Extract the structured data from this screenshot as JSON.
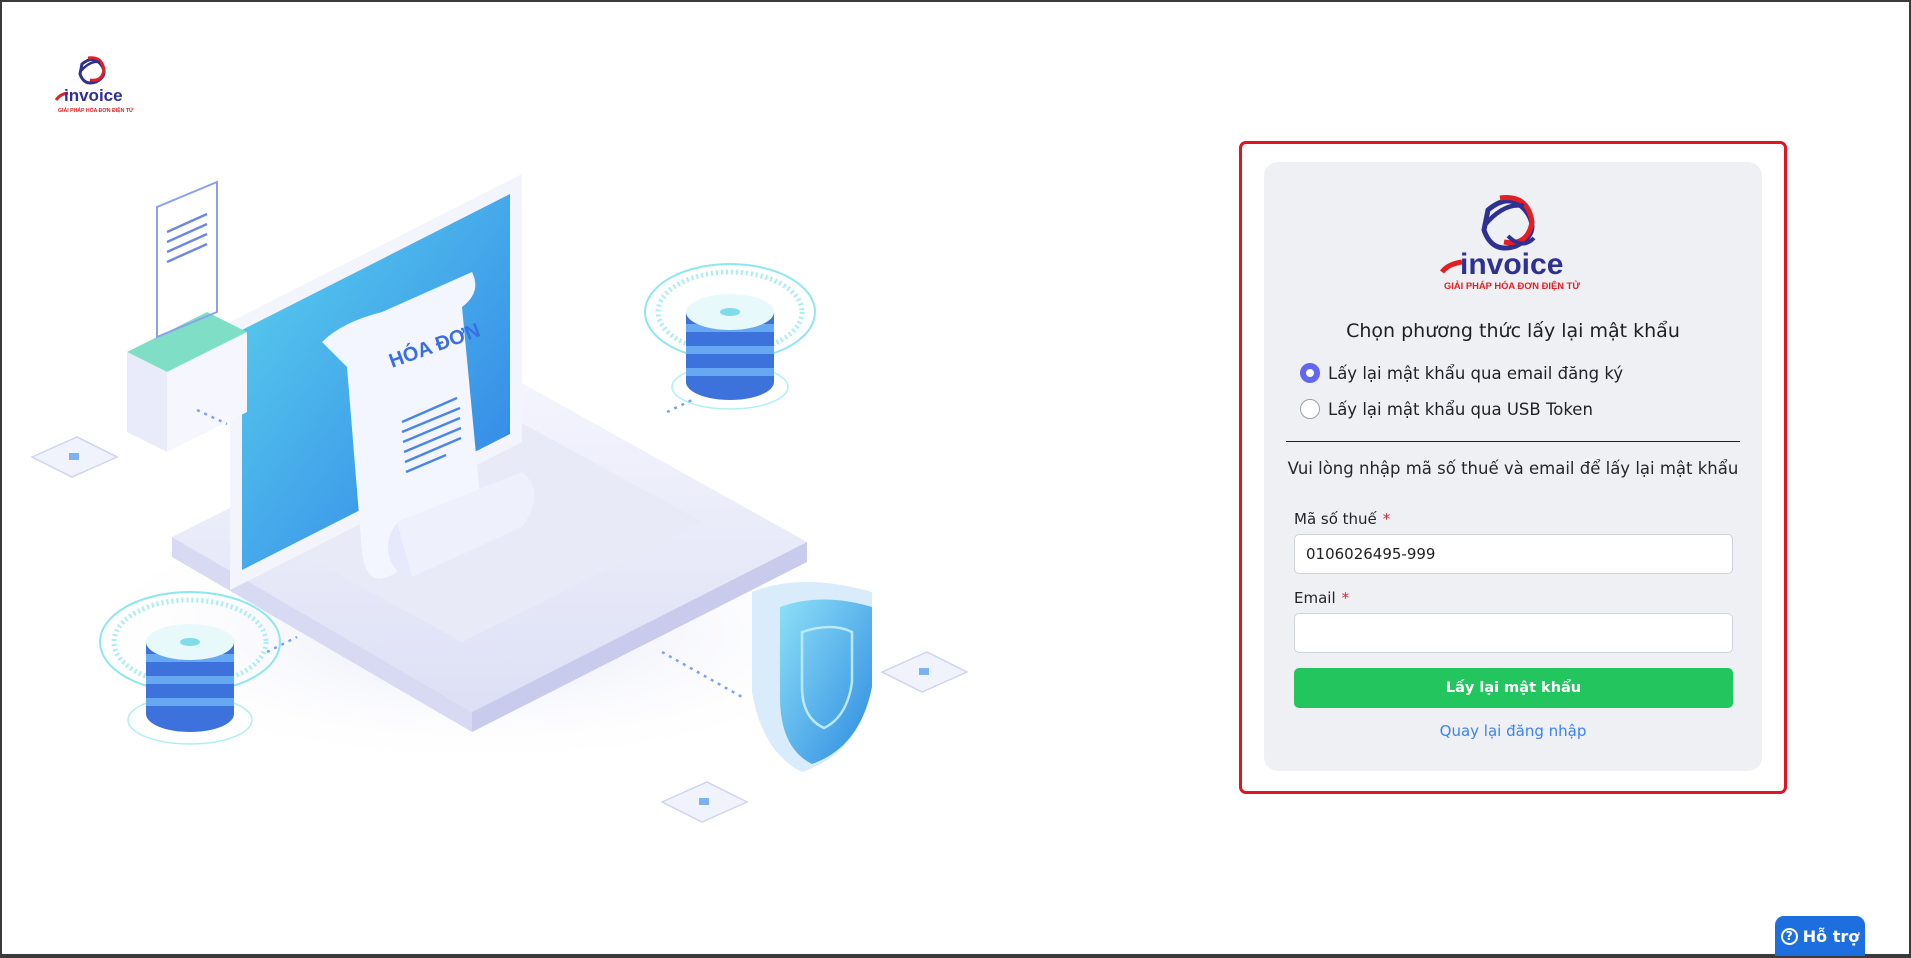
{
  "brand": {
    "name": "invoice",
    "tagline": "GIẢI PHÁP HÓA ĐƠN ĐIỆN TỬ"
  },
  "illustration": {
    "document_text": "HÓA ĐƠN"
  },
  "form": {
    "title": "Chọn phương thức lấy lại mật khẩu",
    "options": [
      {
        "label": "Lấy lại mật khẩu qua email đăng ký",
        "selected": true
      },
      {
        "label": "Lấy lại mật khẩu qua USB Token",
        "selected": false
      }
    ],
    "instructions": "Vui lòng nhập mã số thuế và email để lấy lại mật khẩu",
    "tax_code": {
      "label": "Mã số thuế",
      "required_mark": "*",
      "value": "0106026495-999"
    },
    "email": {
      "label": "Email",
      "required_mark": "*",
      "value": ""
    },
    "submit_label": "Lấy lại mật khẩu",
    "back_link": "Quay lại đăng nhập"
  },
  "help": {
    "icon": "question-circle-icon",
    "label": "Hỗ trợ"
  },
  "colors": {
    "primary_button": "#22c55e",
    "radio_selected": "#6366f1",
    "link": "#3b82f6",
    "highlight_border": "#e0151d",
    "help_button": "#1d6fe0",
    "brand_red": "#e31e24",
    "brand_navy": "#2e3192"
  }
}
